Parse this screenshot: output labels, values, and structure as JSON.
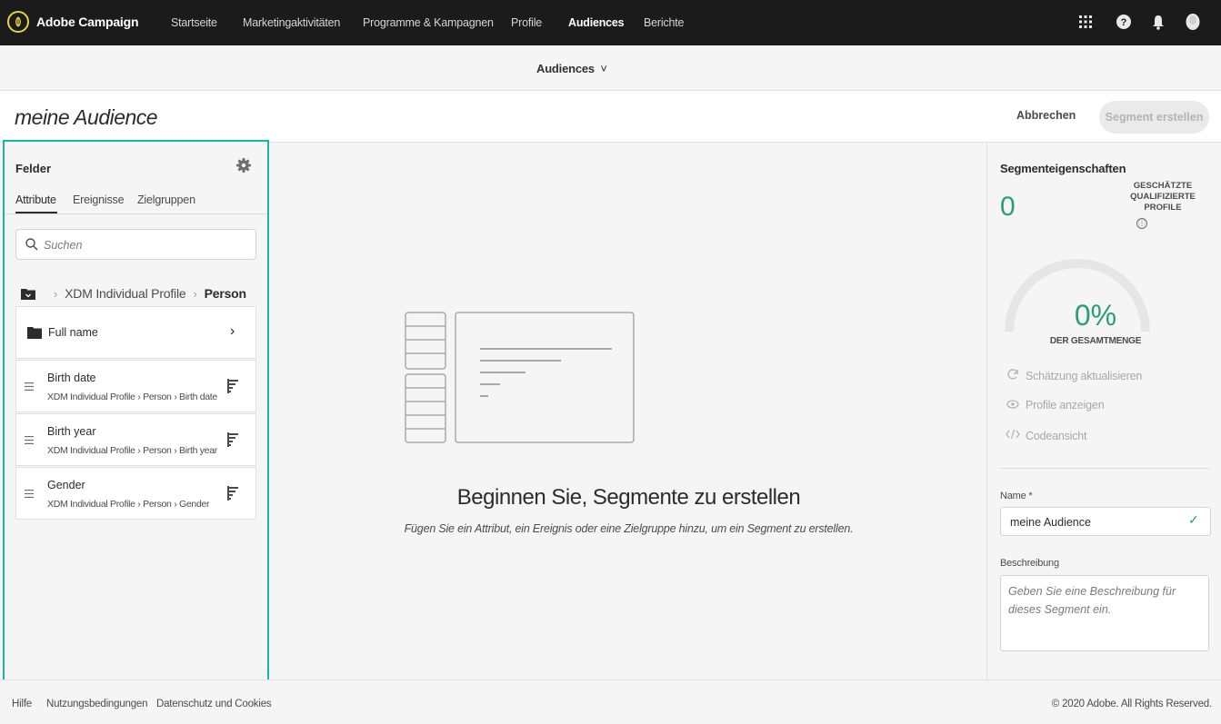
{
  "app": {
    "name": "Adobe Campaign",
    "logo_icon": "adobe-campaign-logo"
  },
  "topnav": {
    "items": [
      {
        "label": "Startseite",
        "active": false
      },
      {
        "label": "Marketingaktivitäten",
        "active": false
      },
      {
        "label": "Programme & Kampagnen",
        "active": false
      },
      {
        "label": "Profile",
        "active": false
      },
      {
        "label": "Audiences",
        "active": true
      },
      {
        "label": "Berichte",
        "active": false
      }
    ],
    "icons": [
      "apps-grid-icon",
      "help-icon",
      "notification-bell-icon",
      "user-avatar-icon"
    ]
  },
  "subnav": {
    "title": "Audiences",
    "chevron": "˅"
  },
  "header": {
    "audience_name": "meine Audience",
    "cancel_label": "Abbrechen",
    "create_label": "Segment erstellen"
  },
  "fields_panel": {
    "title": "Felder",
    "tabs": [
      {
        "label": "Attribute",
        "active": true
      },
      {
        "label": "Ereignisse",
        "active": false
      },
      {
        "label": "Zielgruppen",
        "active": false
      }
    ],
    "search_placeholder": "Suchen",
    "breadcrumb": {
      "root": "XDM Individual Profile",
      "current": "Person",
      "separator": "›"
    },
    "folder": {
      "label": "Full name",
      "arrow": "›"
    },
    "attributes": [
      {
        "label": "Birth date",
        "path": "XDM Individual Profile › Person › Birth date"
      },
      {
        "label": "Birth year",
        "path": "XDM Individual Profile › Person › Birth year"
      },
      {
        "label": "Gender",
        "path": "XDM Individual Profile › Person › Gender"
      }
    ]
  },
  "canvas": {
    "empty_title": "Beginnen Sie, Segmente zu erstellen",
    "empty_subtitle": "Fügen Sie ein Attribut, ein Ereignis oder eine Zielgruppe hinzu, um ein Segment zu erstellen."
  },
  "properties": {
    "title": "Segmenteigenschaften",
    "estimated_count": "0",
    "estimated_label": "GESCHÄTZTE QUALIFIZIERTE PROFILE",
    "info_icon": "ⓘ",
    "percent": "0%",
    "percent_value": 0,
    "percent_label": "DER GESAMTMENGE",
    "actions": [
      {
        "label": "Schätzung aktualisieren",
        "icon": "refresh-icon"
      },
      {
        "label": "Profile anzeigen",
        "icon": "eye-icon"
      },
      {
        "label": "Codeansicht",
        "icon": "code-icon"
      }
    ],
    "name_label": "Name *",
    "name_value": "meine Audience",
    "check": "✓",
    "description_label": "Beschreibung",
    "description_placeholder": "Geben Sie eine Beschreibung für dieses Segment ein."
  },
  "footer": {
    "links": [
      "Hilfe",
      "Nutzungsbedingungen",
      "Datenschutz und Cookies"
    ],
    "copyright": "© 2020 Adobe. All Rights Reserved."
  },
  "colors": {
    "accent": "#15b8a0",
    "green": "#2d9d78",
    "nav_bg": "#1b1b1b",
    "logo": "#e7d04a"
  }
}
